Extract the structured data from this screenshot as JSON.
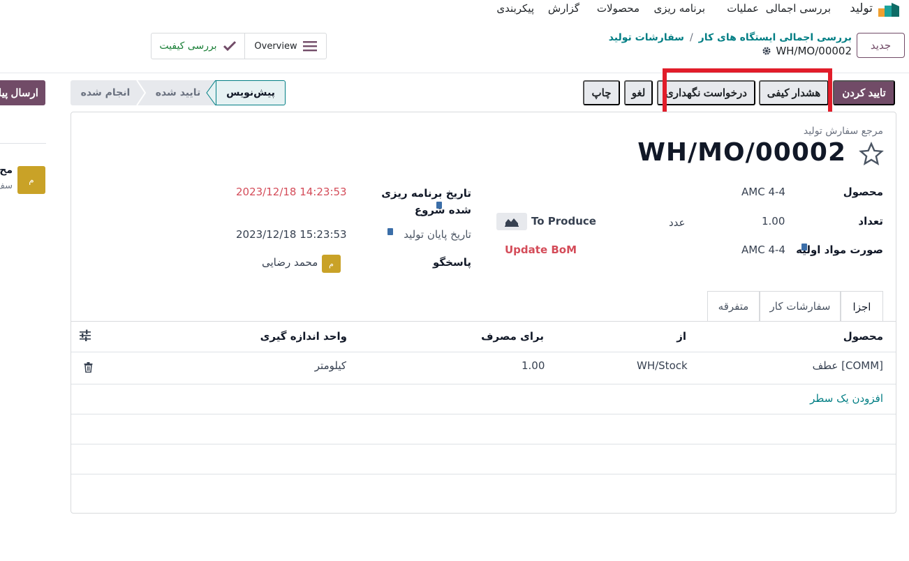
{
  "topnav": {
    "app_name": "تولید",
    "items": [
      "بررسی اجمالی",
      "عملیات",
      "برنامه ریزی",
      "محصولات",
      "گزارش",
      "پیکربندی"
    ]
  },
  "control": {
    "new_label": "جدید",
    "breadcrumb": [
      "بررسی اجمالی ایستگاه های کار",
      "سفارشات تولید"
    ],
    "breadcrumb_sep": "/",
    "record_name": "WH/MO/00002",
    "smart_quality": "بررسی کیفیت",
    "smart_overview": "Overview"
  },
  "actions": {
    "confirm": "تایید کردن",
    "quality_alert": "هشدار کیفی",
    "maintenance_request": "درخواست نگهداری",
    "cancel": "لغو",
    "print": "چاپ"
  },
  "statusbar": {
    "stages": [
      "پیش‌نویس",
      "تایید شده",
      "انجام شده"
    ],
    "current": "پیش‌نویس"
  },
  "chatter": {
    "send_message": "ارسال پیا",
    "avatar_letter": "م",
    "name_partial": "مح",
    "sub_partial": "سف"
  },
  "form": {
    "ref_label": "مرجع سفارش تولید",
    "ref_value": "WH/MO/00002",
    "product_label": "محصول",
    "product_value": "AMC 4-4",
    "qty_label": "تعداد",
    "qty_value": "1.00",
    "qty_uom": "عدد",
    "to_produce": "To Produce",
    "bom_label": "صورت مواد اولیه",
    "bom_value": "AMC 4-4",
    "update_bom": "Update BoM",
    "sched_label": "تاریخ برنامه ریزی شده شروع",
    "sched_value": "2023/12/18 14:23:53",
    "end_label": "تاریخ پایان تولید",
    "end_value": "2023/12/18 15:23:53",
    "resp_label": "پاسخگو",
    "resp_value": "محمد رضایی",
    "resp_avatar": "م",
    "colors": {
      "overdue": "#d44c59",
      "accent": "#714b67",
      "link": "#017e84"
    }
  },
  "tabs": [
    "اجزا",
    "سفارشات کار",
    "متفرقه"
  ],
  "table": {
    "headers": [
      "محصول",
      "از",
      "برای مصرف",
      "واحد اندازه گیری"
    ],
    "rows": [
      {
        "product": "[COMM] عطف",
        "from": "WH/Stock",
        "consume": "1.00",
        "uom": "کیلومتر"
      }
    ],
    "add_line": "افزودن یک سطر"
  }
}
